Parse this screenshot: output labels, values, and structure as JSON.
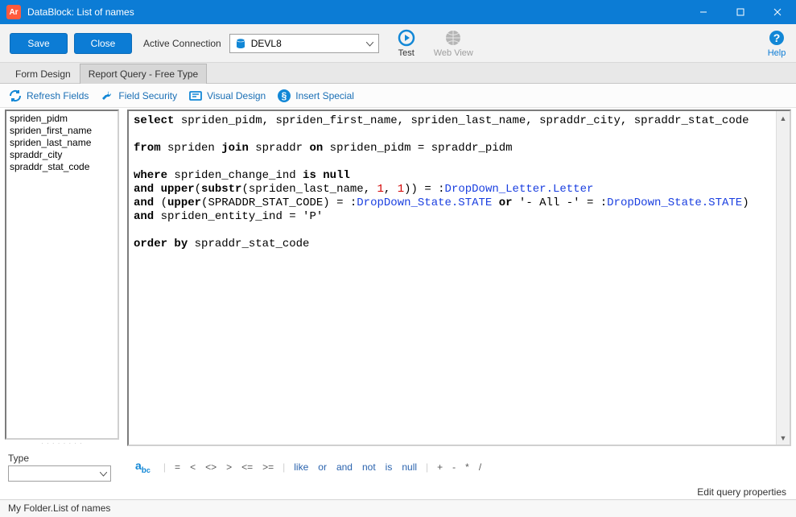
{
  "title": "DataBlock: List of names",
  "app_icon_text": "Ar",
  "toolbar": {
    "save": "Save",
    "close": "Close",
    "active_connection_label": "Active Connection",
    "connection_value": "DEVL8",
    "test": "Test",
    "web_view": "Web View",
    "help": "Help"
  },
  "tabs": {
    "form_design": "Form Design",
    "report_query": "Report Query - Free Type"
  },
  "toolbar2": {
    "refresh_fields": "Refresh Fields",
    "field_security": "Field Security",
    "visual_design": "Visual Design",
    "insert_special": "Insert Special"
  },
  "fields": [
    "spriden_pidm",
    "spriden_first_name",
    "spriden_last_name",
    "spraddr_city",
    "spraddr_stat_code"
  ],
  "sql": {
    "tokens": [
      {
        "t": "kw",
        "v": "select"
      },
      {
        "t": "sp"
      },
      {
        "t": "id",
        "v": "spriden_pidm"
      },
      {
        "t": "p",
        "v": ", "
      },
      {
        "t": "id",
        "v": "spriden_first_name"
      },
      {
        "t": "p",
        "v": ", "
      },
      {
        "t": "id",
        "v": "spriden_last_name"
      },
      {
        "t": "p",
        "v": ", "
      },
      {
        "t": "id",
        "v": "spraddr_city"
      },
      {
        "t": "p",
        "v": ", "
      },
      {
        "t": "id",
        "v": "spraddr_stat_code"
      },
      {
        "t": "nl"
      },
      {
        "t": "nl"
      },
      {
        "t": "kw",
        "v": "from"
      },
      {
        "t": "sp"
      },
      {
        "t": "id",
        "v": "spriden"
      },
      {
        "t": "sp"
      },
      {
        "t": "kw",
        "v": "join"
      },
      {
        "t": "sp"
      },
      {
        "t": "id",
        "v": "spraddr"
      },
      {
        "t": "sp"
      },
      {
        "t": "kw",
        "v": "on"
      },
      {
        "t": "sp"
      },
      {
        "t": "id",
        "v": "spriden_pidm"
      },
      {
        "t": "sp"
      },
      {
        "t": "p",
        "v": "="
      },
      {
        "t": "sp"
      },
      {
        "t": "id",
        "v": "spraddr_pidm"
      },
      {
        "t": "nl"
      },
      {
        "t": "nl"
      },
      {
        "t": "kw",
        "v": "where"
      },
      {
        "t": "sp"
      },
      {
        "t": "id",
        "v": "spriden_change_ind"
      },
      {
        "t": "sp"
      },
      {
        "t": "kw",
        "v": "is"
      },
      {
        "t": "sp"
      },
      {
        "t": "kw",
        "v": "null"
      },
      {
        "t": "nl"
      },
      {
        "t": "kw",
        "v": "and"
      },
      {
        "t": "sp"
      },
      {
        "t": "kw",
        "v": "upper"
      },
      {
        "t": "p",
        "v": "("
      },
      {
        "t": "kw",
        "v": "substr"
      },
      {
        "t": "p",
        "v": "("
      },
      {
        "t": "id",
        "v": "spriden_last_name"
      },
      {
        "t": "p",
        "v": ", "
      },
      {
        "t": "num",
        "v": "1"
      },
      {
        "t": "p",
        "v": ", "
      },
      {
        "t": "num",
        "v": "1"
      },
      {
        "t": "p",
        "v": "))"
      },
      {
        "t": "sp"
      },
      {
        "t": "p",
        "v": "="
      },
      {
        "t": "sp"
      },
      {
        "t": "p",
        "v": ":"
      },
      {
        "t": "bind",
        "v": "DropDown_Letter.Letter"
      },
      {
        "t": "nl"
      },
      {
        "t": "kw",
        "v": "and"
      },
      {
        "t": "sp"
      },
      {
        "t": "p",
        "v": "("
      },
      {
        "t": "kw",
        "v": "upper"
      },
      {
        "t": "p",
        "v": "("
      },
      {
        "t": "id",
        "v": "SPRADDR_STAT_CODE"
      },
      {
        "t": "p",
        "v": ")"
      },
      {
        "t": "sp"
      },
      {
        "t": "p",
        "v": "="
      },
      {
        "t": "sp"
      },
      {
        "t": "p",
        "v": ":"
      },
      {
        "t": "bind",
        "v": "DropDown_State.STATE"
      },
      {
        "t": "sp"
      },
      {
        "t": "kw",
        "v": "or"
      },
      {
        "t": "sp"
      },
      {
        "t": "p",
        "v": "'- All -'"
      },
      {
        "t": "sp"
      },
      {
        "t": "p",
        "v": "="
      },
      {
        "t": "sp"
      },
      {
        "t": "p",
        "v": ":"
      },
      {
        "t": "bind",
        "v": "DropDown_State.STATE"
      },
      {
        "t": "p",
        "v": ")"
      },
      {
        "t": "nl"
      },
      {
        "t": "kw",
        "v": "and"
      },
      {
        "t": "sp"
      },
      {
        "t": "id",
        "v": "spriden_entity_ind"
      },
      {
        "t": "sp"
      },
      {
        "t": "p",
        "v": "="
      },
      {
        "t": "sp"
      },
      {
        "t": "p",
        "v": "'P'"
      },
      {
        "t": "nl"
      },
      {
        "t": "nl"
      },
      {
        "t": "kw",
        "v": "order"
      },
      {
        "t": "sp"
      },
      {
        "t": "kw",
        "v": "by"
      },
      {
        "t": "sp"
      },
      {
        "t": "id",
        "v": "spraddr_stat_code"
      }
    ]
  },
  "type_label": "Type",
  "operators": {
    "g1": [
      "=",
      "<",
      "<>",
      ">",
      "<=",
      ">="
    ],
    "g2": [
      "like",
      "or",
      "and",
      "not",
      "is",
      "null"
    ],
    "g3": [
      "+",
      "-",
      "*",
      "/"
    ]
  },
  "edit_query_properties": "Edit query properties",
  "status": "My Folder.List of names"
}
